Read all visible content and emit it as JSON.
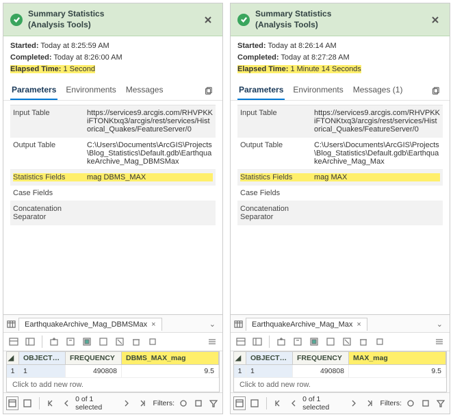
{
  "panes": [
    {
      "title_line1": "Summary Statistics",
      "title_line2": "(Analysis Tools)",
      "started_label": "Started:",
      "started_value": "Today at 8:25:59 AM",
      "completed_label": "Completed:",
      "completed_value": "Today at 8:26:00 AM",
      "elapsed_label": "Elapsed Time:",
      "elapsed_value": "1 Second",
      "tabs": {
        "parameters": "Parameters",
        "environments": "Environments",
        "messages": "Messages"
      },
      "params": {
        "input_table_k": "Input Table",
        "input_table_v": "https://services9.arcgis.com/RHVPKKiFTONKtxq3/arcgis/rest/services/Historical_Quakes/FeatureServer/0",
        "output_table_k": "Output Table",
        "output_table_v": "C:\\Users\\Documents\\ArcGIS\\Projects\\Blog_Statistics\\Default.gdb\\EarthquakeArchive_Mag_DBMSMax",
        "stat_fields_k": "Statistics Fields",
        "stat_fields_v": "mag DBMS_MAX",
        "case_fields_k": "Case Fields",
        "concat_k": "Concatenation Separator"
      },
      "table": {
        "tab_name": "EarthquakeArchive_Mag_DBMSMax",
        "columns": {
          "c1": "OBJECTID *",
          "c2": "FREQUENCY",
          "c3": "DBMS_MAX_mag"
        },
        "row": {
          "idx": "1",
          "c1": "1",
          "c2": "490808",
          "c3": "9.5"
        },
        "add_row": "Click to add new row.",
        "status": "0 of 1 selected",
        "filters": "Filters:"
      }
    },
    {
      "title_line1": "Summary Statistics",
      "title_line2": "(Analysis Tools)",
      "started_label": "Started:",
      "started_value": "Today at 8:26:14 AM",
      "completed_label": "Completed:",
      "completed_value": "Today at 8:27:28 AM",
      "elapsed_label": "Elapsed Time:",
      "elapsed_value": "1 Minute 14 Seconds",
      "tabs": {
        "parameters": "Parameters",
        "environments": "Environments",
        "messages": "Messages (1)"
      },
      "params": {
        "input_table_k": "Input Table",
        "input_table_v": "https://services9.arcgis.com/RHVPKKiFTONKtxq3/arcgis/rest/services/Historical_Quakes/FeatureServer/0",
        "output_table_k": "Output Table",
        "output_table_v": "C:\\Users\\Documents\\ArcGIS\\Projects\\Blog_Statistics\\Default.gdb\\EarthquakeArchive_Mag_Max",
        "stat_fields_k": "Statistics Fields",
        "stat_fields_v": "mag MAX",
        "case_fields_k": "Case Fields",
        "concat_k": "Concatenation Separator"
      },
      "table": {
        "tab_name": "EarthquakeArchive_Mag_Max",
        "columns": {
          "c1": "OBJECTID *",
          "c2": "FREQUENCY",
          "c3": "MAX_mag"
        },
        "row": {
          "idx": "1",
          "c1": "1",
          "c2": "490808",
          "c3": "9.5"
        },
        "add_row": "Click to add new row.",
        "status": "0 of 1 selected",
        "filters": "Filters:"
      }
    }
  ]
}
